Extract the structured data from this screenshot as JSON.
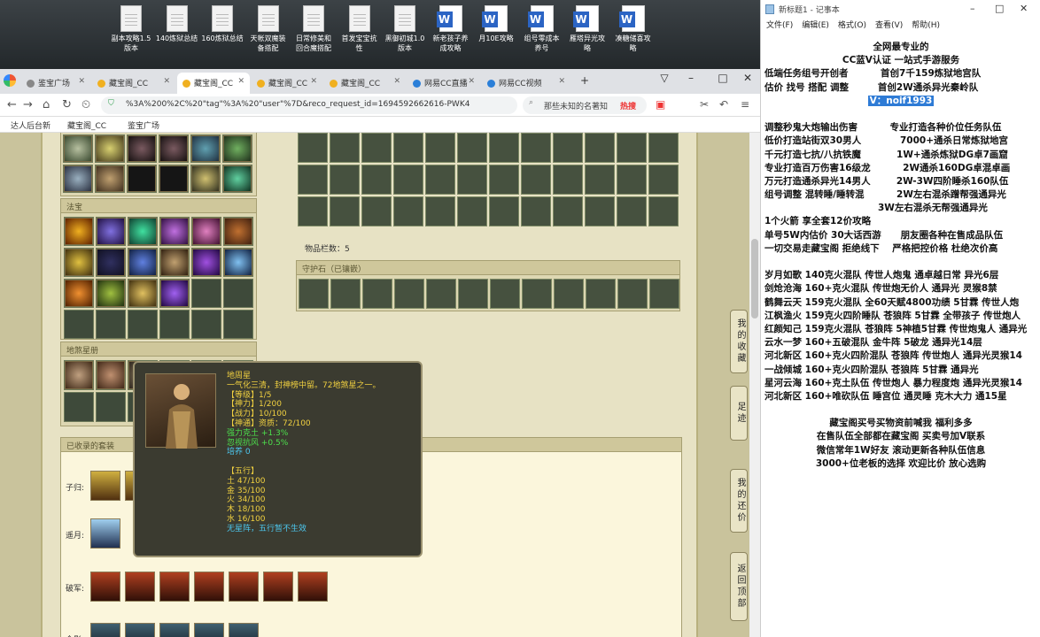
{
  "desktop": {
    "icons": [
      {
        "label": "副本攻略1.5\n版本",
        "type": "doc"
      },
      {
        "label": "140炼狱总结",
        "type": "doc"
      },
      {
        "label": "160炼狱总结",
        "type": "doc"
      },
      {
        "label": "天帐双魔装\n备搭配",
        "type": "doc"
      },
      {
        "label": "日常修美和\n回合魔搭配",
        "type": "doc"
      },
      {
        "label": "首发宝宝抗\n性",
        "type": "doc"
      },
      {
        "label": "黑御初城1.0\n版本",
        "type": "doc"
      },
      {
        "label": "新老孩子养\n成攻略",
        "type": "word"
      },
      {
        "label": "月10E攻略",
        "type": "word"
      },
      {
        "label": "组号零成本\n养号",
        "type": "word"
      },
      {
        "label": "雁塔异光攻\n略",
        "type": "word"
      },
      {
        "label": "凑糖储喜攻\n略",
        "type": "word"
      }
    ]
  },
  "browser": {
    "tabs": [
      {
        "label": "鉴宝广场"
      },
      {
        "label": "藏宝阁_CC"
      },
      {
        "label": "藏宝阁_CC",
        "active": true
      },
      {
        "label": "藏宝阁_CC"
      },
      {
        "label": "藏宝阁_CC"
      },
      {
        "label": "网易CC直播"
      },
      {
        "label": "网易CC视频"
      }
    ],
    "url": "%3A%200%2C%20\"tag\"%3A%20\"user\"%7D&reco_request_id=1694592662616-PWK4",
    "search_text": "那些未知的名著知",
    "hot_label": "热搜",
    "bookmarks": [
      "达人后台新",
      "藏宝阁_CC",
      "鉴宝广场"
    ]
  },
  "game": {
    "fabao_title": "法宝",
    "dishaxing_title": "地煞星册",
    "item_count_label": "物品栏数：5",
    "guardian_title": "守护石（已镶嵌）",
    "collected_title": "已收录的套装",
    "sets": [
      {
        "name": "子归:"
      },
      {
        "name": "遥月:"
      },
      {
        "name": "破军:"
      },
      {
        "name": "金影:"
      }
    ],
    "side_buttons": [
      {
        "label": "我的收藏"
      },
      {
        "label": "足迹"
      },
      {
        "label": "我的还价"
      },
      {
        "label": "返回顶部"
      }
    ],
    "tooltip": {
      "name": "地周星",
      "desc": "一气化三清，封神榜中留。72地煞星之一。",
      "stats": [
        {
          "text": "【等级】1/5",
          "color": "#f0d040"
        },
        {
          "text": "【神力】1/200",
          "color": "#f0d040"
        },
        {
          "text": "【战力】10/100",
          "color": "#f0d040"
        },
        {
          "text": "【神通】资质：72/100",
          "color": "#f0d040"
        },
        {
          "text": "强力克土 +1.3%",
          "color": "#4ce04c"
        },
        {
          "text": "忽视抗风 +0.5%",
          "color": "#4ce04c"
        },
        {
          "text": "培养 0",
          "color": "#4cc8f0"
        },
        {
          "text": "",
          "color": "#fff"
        },
        {
          "text": "【五行】",
          "color": "#f0d040"
        },
        {
          "text": "土 47/100",
          "color": "#f0d040"
        },
        {
          "text": "金 35/100",
          "color": "#f0d040"
        },
        {
          "text": "火 34/100",
          "color": "#f0d040"
        },
        {
          "text": "木 18/100",
          "color": "#f0d040"
        },
        {
          "text": "水 16/100",
          "color": "#f0d040"
        },
        {
          "text": "无星阵，五行暂不生效",
          "color": "#4cc8f0"
        }
      ]
    }
  },
  "notepad": {
    "title": "新标题1 - 记事本",
    "menu": [
      "文件(F)",
      "编辑(E)",
      "格式(O)",
      "查看(V)",
      "帮助(H)"
    ],
    "lines": [
      {
        "t": "全网最专业的",
        "c": true
      },
      {
        "t": "CC蓝V认证 一站式手游服务",
        "c": true
      },
      {
        "t": "低端任务组号开创者          首创7千159炼狱地宫队"
      },
      {
        "t": "估价 找号 搭配 调整         首创2W通杀异光秦岭队"
      },
      {
        "t": "V：noif1993",
        "c": true,
        "sel": true
      },
      {
        "t": ""
      },
      {
        "t": "调整秒鬼大炮输出伤害          专业打造各种价位任务队伍"
      },
      {
        "t": "低价打造站街双30男人            7000+通杀日常炼狱地宫"
      },
      {
        "t": "千元打造七抗/八抗铁魔           1W+通杀炼狱DG卓7画窟"
      },
      {
        "t": "专业打造百万伤害16级龙          2W通杀160DG卓混卓画"
      },
      {
        "t": "万元打造通杀异光14男人        2W-3W四阶睡杀160队伍"
      },
      {
        "t": "组号调整 混转睡/睡转混          2W左右混杀蹭帮强通异光"
      },
      {
        "t": "                                   3W左右混杀无帮强通异光"
      },
      {
        "t": "1个火箭 享全套12价攻略"
      },
      {
        "t": "单号5W内估价 30大话西游      朋友圈各种在售成品队伍"
      },
      {
        "t": "一切交易走藏宝阁 拒绝线下    严格把控价格 杜绝次价高"
      },
      {
        "t": ""
      },
      {
        "t": "岁月如歌 140克火混队 传世人炮鬼 通卓越日常 异光6层"
      },
      {
        "t": "剑炝沧海 160+克火混队 传世炮无价人 通异光 灵猴8禁"
      },
      {
        "t": "鹤舞云天 159克火混队 全60天赋4800功绩 5甘霖 传世人炮"
      },
      {
        "t": "江枫渔火 159克火四阶睡队 苍狼阵 5甘霖 全带孩子 传世炮人"
      },
      {
        "t": "红颜知己 159克火混队 苍狼阵 5神植5甘霖 传世炮鬼人 通异光"
      },
      {
        "t": "云水一梦 160+五破混队 金牛阵 5破龙 通异光14层"
      },
      {
        "t": "河北新区 160+克火四阶混队 苍狼阵 传世炮人 通异光灵猴14"
      },
      {
        "t": "一战倾城 160+克火四阶混队 苍狼阵 5甘霖 通异光"
      },
      {
        "t": "星河云海 160+克土队伍 传世炮人 暴力程度炮 通异光灵猴14"
      },
      {
        "t": "河北新区 160+唯砍队伍 睡宫位 通灵睡 克木大力 通15星"
      },
      {
        "t": ""
      },
      {
        "t": "藏宝阁买号买物资前喊我 福利多多",
        "c": true
      },
      {
        "t": "在售队伍全部都在藏宝阁 买卖号加V联系",
        "c": true
      },
      {
        "t": "微信常年1W好友 滚动更新各种队伍信息",
        "c": true
      },
      {
        "t": "3000+位老板的选择 欢迎比价 放心选购",
        "c": true
      }
    ]
  }
}
